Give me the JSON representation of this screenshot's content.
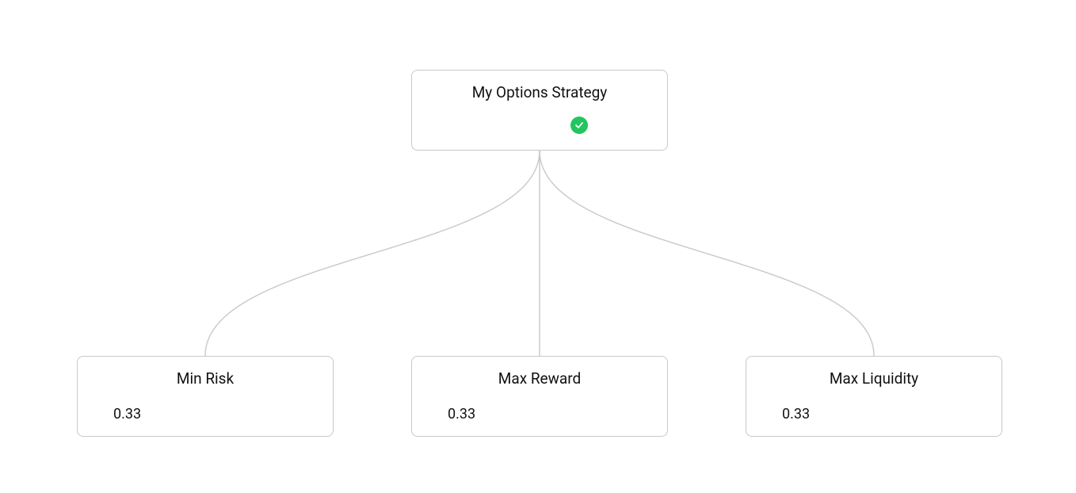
{
  "root": {
    "title": "My Options Strategy",
    "status_icon": "check-circle-icon",
    "status_color": "#22c55e"
  },
  "children": [
    {
      "title": "Min Risk",
      "value": "0.33"
    },
    {
      "title": "Max Reward",
      "value": "0.33"
    },
    {
      "title": "Max Liquidity",
      "value": "0.33"
    }
  ],
  "chart_data": {
    "type": "diagram-tree",
    "root": {
      "label": "My Options Strategy",
      "status": "complete"
    },
    "children": [
      {
        "label": "Min Risk",
        "weight": 0.33
      },
      {
        "label": "Max Reward",
        "weight": 0.33
      },
      {
        "label": "Max Liquidity",
        "weight": 0.33
      }
    ]
  }
}
